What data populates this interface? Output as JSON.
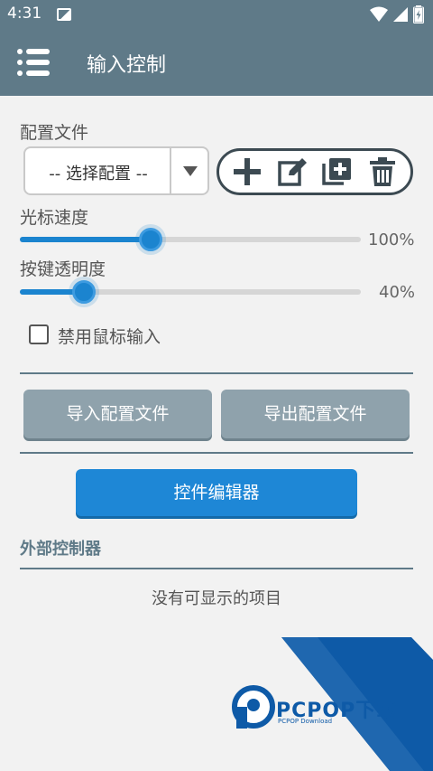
{
  "statusbar": {
    "time": "4:31"
  },
  "appbar": {
    "title": "输入控制"
  },
  "config": {
    "label": "配置文件",
    "selected": "-- 选择配置 --"
  },
  "cursor_speed": {
    "label": "光标速度",
    "percent_text": "100%",
    "value": 1.0
  },
  "button_opacity": {
    "label": "按键透明度",
    "percent_text": "40%",
    "value": 0.4
  },
  "disable_mouse": {
    "label": "禁用鼠标输入",
    "checked": false
  },
  "buttons": {
    "import": "导入配置文件",
    "export": "导出配置文件",
    "editor": "控件编辑器"
  },
  "external": {
    "heading": "外部控制器",
    "empty_text": "没有可显示的项目"
  },
  "watermark": {
    "brand": "PCPOP下载",
    "sub": "PCPOP Download"
  },
  "colors": {
    "appbar": "#5f7a88",
    "accent": "#1b84cf",
    "gray_button": "#8fa2ac",
    "watermark": "#0e5aa7"
  }
}
